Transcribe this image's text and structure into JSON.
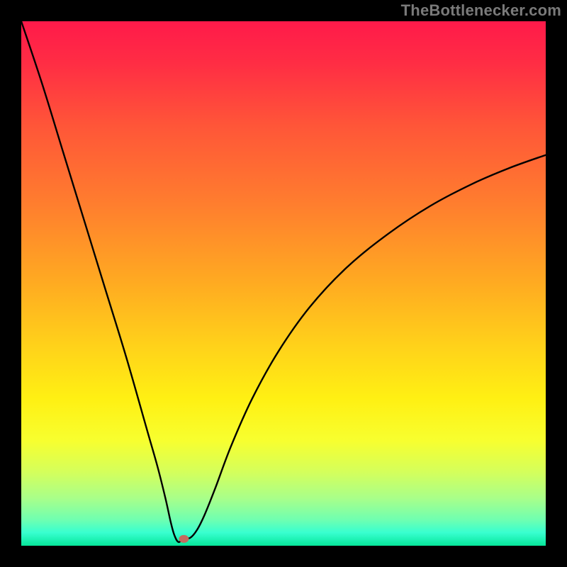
{
  "watermark": "TheBottlenecker.com",
  "gradient_stops": [
    {
      "offset": 0.0,
      "color": "#ff1a4a"
    },
    {
      "offset": 0.08,
      "color": "#ff2d44"
    },
    {
      "offset": 0.2,
      "color": "#ff5638"
    },
    {
      "offset": 0.35,
      "color": "#ff7e2e"
    },
    {
      "offset": 0.5,
      "color": "#ffab21"
    },
    {
      "offset": 0.62,
      "color": "#ffd21a"
    },
    {
      "offset": 0.72,
      "color": "#fff013"
    },
    {
      "offset": 0.8,
      "color": "#f7ff2f"
    },
    {
      "offset": 0.86,
      "color": "#d4ff5c"
    },
    {
      "offset": 0.91,
      "color": "#a8ff8a"
    },
    {
      "offset": 0.95,
      "color": "#70ffb0"
    },
    {
      "offset": 0.975,
      "color": "#38ffd0"
    },
    {
      "offset": 1.0,
      "color": "#06e69a"
    }
  ],
  "marker": {
    "x_frac": 0.31,
    "y_frac": 0.987,
    "rx": 7,
    "ry": 5.5,
    "fill": "#c46a5e"
  },
  "chart_data": {
    "type": "line",
    "title": "",
    "xlabel": "",
    "ylabel": "",
    "xlim": [
      0,
      1
    ],
    "ylim": [
      0,
      1
    ],
    "grid": false,
    "legend": false,
    "series": [
      {
        "name": "bottleneck-curve",
        "x": [
          0.0,
          0.04,
          0.08,
          0.12,
          0.16,
          0.2,
          0.24,
          0.26,
          0.275,
          0.285,
          0.292,
          0.3,
          0.31,
          0.322,
          0.335,
          0.35,
          0.37,
          0.4,
          0.44,
          0.49,
          0.55,
          0.62,
          0.7,
          0.78,
          0.86,
          0.93,
          1.0
        ],
        "y": [
          0.0,
          0.12,
          0.25,
          0.38,
          0.51,
          0.64,
          0.78,
          0.85,
          0.91,
          0.955,
          0.98,
          0.993,
          0.985,
          0.985,
          0.97,
          0.94,
          0.89,
          0.81,
          0.72,
          0.63,
          0.545,
          0.47,
          0.405,
          0.352,
          0.31,
          0.28,
          0.255
        ]
      }
    ],
    "annotations": [
      {
        "type": "marker",
        "x": 0.31,
        "y": 0.987,
        "label": "optimal-point"
      }
    ]
  }
}
